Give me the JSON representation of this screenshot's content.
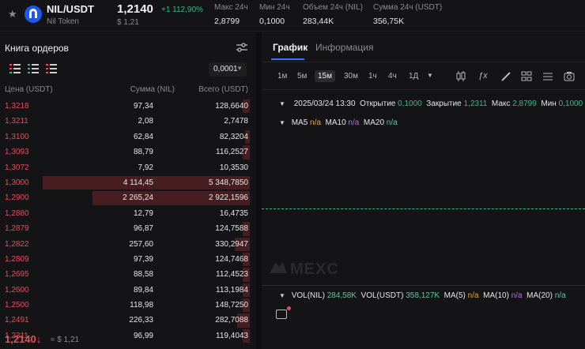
{
  "header": {
    "pair": "NIL/USDT",
    "token_name": "Nil Token",
    "last_price": "1,2140",
    "change": "+1 112,90%",
    "usd_price": "$ 1,21",
    "stats": [
      {
        "label": "Макс 24ч",
        "value": "2,8799"
      },
      {
        "label": "Мин 24ч",
        "value": "0,1000"
      },
      {
        "label": "Объем 24ч (NIL)",
        "value": "283,44K"
      },
      {
        "label": "Сумма 24ч (USDT)",
        "value": "356,75K"
      }
    ]
  },
  "orderbook": {
    "title": "Книга ордеров",
    "precision": "0,0001",
    "columns": {
      "price": "Цена (USDT)",
      "amount": "Сумма (NIL)",
      "total": "Всего (USDT)"
    },
    "rows": [
      {
        "price": "1,3218",
        "amount": "97,34",
        "total": "128,6640",
        "depth": 0.03
      },
      {
        "price": "1,3211",
        "amount": "2,08",
        "total": "2,7478",
        "depth": 0.0
      },
      {
        "price": "1,3100",
        "amount": "62,84",
        "total": "82,3204",
        "depth": 0.02
      },
      {
        "price": "1,3093",
        "amount": "88,79",
        "total": "116,2527",
        "depth": 0.03
      },
      {
        "price": "1,3072",
        "amount": "7,92",
        "total": "10,3530",
        "depth": 0.0
      },
      {
        "price": "1,3000",
        "amount": "4 114,45",
        "total": "5 348,7850",
        "depth": 0.83
      },
      {
        "price": "1,2900",
        "amount": "2 265,24",
        "total": "2 922,1596",
        "depth": 0.63
      },
      {
        "price": "1,2880",
        "amount": "12,79",
        "total": "16,4735",
        "depth": 0.0
      },
      {
        "price": "1,2879",
        "amount": "96,87",
        "total": "124,7588",
        "depth": 0.03
      },
      {
        "price": "1,2822",
        "amount": "257,60",
        "total": "330,2947",
        "depth": 0.06
      },
      {
        "price": "1,2809",
        "amount": "97,39",
        "total": "124,7468",
        "depth": 0.03
      },
      {
        "price": "1,2695",
        "amount": "88,58",
        "total": "112,4523",
        "depth": 0.03
      },
      {
        "price": "1,2600",
        "amount": "89,84",
        "total": "113,1984",
        "depth": 0.03
      },
      {
        "price": "1,2500",
        "amount": "118,98",
        "total": "148,7250",
        "depth": 0.03
      },
      {
        "price": "1,2491",
        "amount": "226,33",
        "total": "282,7088",
        "depth": 0.05
      },
      {
        "price": "1,2311",
        "amount": "96,99",
        "total": "119,4043",
        "depth": 0.03
      }
    ],
    "footer": {
      "price": "1,2140",
      "arrow": "↓",
      "usd": "≈ $ 1,21"
    }
  },
  "chart_panel": {
    "tabs": {
      "chart": "График",
      "info": "Информация"
    },
    "intervals": [
      "1м",
      "5м",
      "15м",
      "30м",
      "1ч",
      "4ч",
      "1Д"
    ],
    "active_interval": "15м",
    "candle": {
      "date": "2025/03/24 13:30",
      "open_label": "Открытие",
      "open": "0,1000",
      "close_label": "Закрытие",
      "close": "1,2311",
      "high_label": "Макс",
      "high": "2,8799",
      "low_label": "Мин",
      "low": "0,1000"
    },
    "ma": {
      "ma5": "MA5",
      "ma10": "MA10",
      "ma20": "MA20",
      "na": "n/a"
    },
    "volume": {
      "vol_nil_label": "VOL(NIL)",
      "vol_nil": "284,58K",
      "vol_usdt_label": "VOL(USDT)",
      "vol_usdt": "358,127K",
      "ma5": "MA(5)",
      "ma10": "MA(10)",
      "ma20": "MA(20)",
      "na": "n/a"
    },
    "watermark": "MEXC"
  },
  "colors": {
    "up": "#2fbd85",
    "down": "#e44d5a",
    "accent": "#3a72f5",
    "brand": "#1d57f2"
  }
}
